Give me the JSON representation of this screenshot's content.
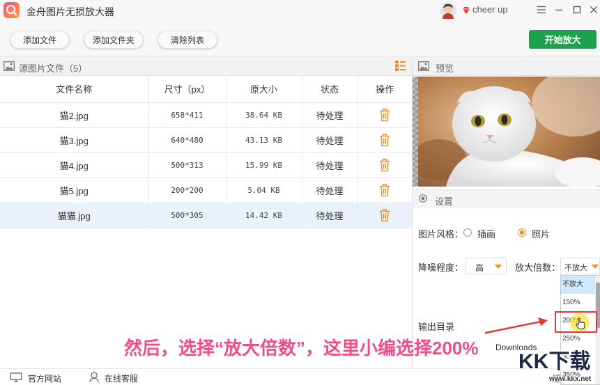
{
  "app": {
    "title": "金舟图片无损放大器",
    "user_name": "cheer up"
  },
  "toolbar": {
    "add_file": "添加文件",
    "add_folder": "添加文件夹",
    "clear_list": "清除列表",
    "start": "开始放大"
  },
  "source_panel": {
    "title": "源图片文件（5）",
    "columns": [
      "文件名称",
      "尺寸（px）",
      "原大小",
      "状态",
      "操作"
    ],
    "rows": [
      {
        "name": "猫2.jpg",
        "size_px": "658*411",
        "file_size": "38.64 KB",
        "status": "待处理"
      },
      {
        "name": "猫3.jpg",
        "size_px": "640*480",
        "file_size": "43.13 KB",
        "status": "待处理"
      },
      {
        "name": "猫4.jpg",
        "size_px": "500*313",
        "file_size": "15.99 KB",
        "status": "待处理"
      },
      {
        "name": "猫5.jpg",
        "size_px": "200*200",
        "file_size": "5.04 KB",
        "status": "待处理"
      },
      {
        "name": "猫猫.jpg",
        "size_px": "500*305",
        "file_size": "14.42 KB",
        "status": "待处理"
      }
    ],
    "selected_row_index": 4
  },
  "preview": {
    "title": "预览"
  },
  "settings": {
    "title": "设置",
    "style_label": "图片风格：",
    "style_options": [
      "插画",
      "照片"
    ],
    "style_selected_index": 1,
    "denoise_label": "降噪程度：",
    "denoise_value": "高",
    "scale_label": "放大倍数：",
    "scale_value": "不放大",
    "scale_options": [
      "不放大",
      "150%",
      "200%",
      "250%",
      "300%",
      "350%"
    ],
    "scale_current_index": 0,
    "scale_highlight_index": 2,
    "output_label": "输出目录",
    "output_path": "Downloads"
  },
  "caption": "然后，选择“放大倍数”，这里小编选择200%",
  "footer": {
    "website": "官方网站",
    "support": "在线客服",
    "version_fragment": "版"
  },
  "watermark": {
    "logo": "KK下载",
    "url": "www.kkx.net"
  },
  "colors": {
    "accent": "#f08a24",
    "start_button": "#1ba24c",
    "selected_row": "#e9f2fb",
    "dropdown_current": "#cfe8fa",
    "caption": "#ef4d86",
    "highlight_box": "#e53935",
    "arrow": "#e53935"
  },
  "icons": {
    "app_logo": "magnifier-logo-icon",
    "vip": "diamond-icon",
    "window": [
      "menu-icon",
      "minimize-icon",
      "maximize-icon",
      "close-icon"
    ],
    "panel": [
      "picture-icon",
      "list-view-icon",
      "settings-radio-icon"
    ],
    "row_action": "trash-icon",
    "footer": [
      "monitor-icon",
      "headset-icon"
    ]
  }
}
